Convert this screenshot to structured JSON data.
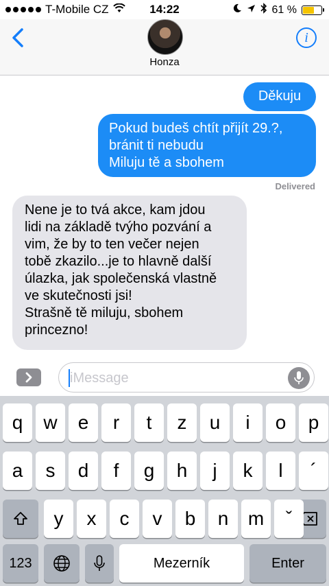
{
  "status_bar": {
    "carrier": "T-Mobile CZ",
    "time": "14:22",
    "battery_percent": "61 %",
    "battery_level": 0.61
  },
  "header": {
    "contact_name": "Honza",
    "back_icon": "chevron-left-icon",
    "info_icon": "info-icon",
    "accent": "#147efb"
  },
  "messages": [
    {
      "direction": "sent",
      "lines": [
        "Děkuju"
      ]
    },
    {
      "direction": "sent",
      "lines": [
        "Pokud budeš chtít přijít 29.?,",
        "bránit ti nebudu",
        "Miluju tě a sbohem"
      ]
    },
    {
      "direction": "received",
      "lines": [
        "Nene je to tvá akce, kam jdou",
        "lidi na základě tvýho pozvání a",
        "vim, že by to ten večer nejen",
        "tobě zkazilo...je to hlavně další",
        "úlazka, jak společenská vlastně",
        "ve skutečnosti jsi!",
        "Strašně tě miluju, sbohem",
        "princezno!"
      ]
    }
  ],
  "delivered_label": "Delivered",
  "input": {
    "placeholder": "iMessage",
    "value": ""
  },
  "keyboard": {
    "row1": [
      "q",
      "w",
      "e",
      "r",
      "t",
      "z",
      "u",
      "i",
      "o",
      "p"
    ],
    "row2": [
      "a",
      "s",
      "d",
      "f",
      "g",
      "h",
      "j",
      "k",
      "l",
      "´"
    ],
    "row3": [
      "y",
      "x",
      "c",
      "v",
      "b",
      "n",
      "m",
      "ˇ"
    ],
    "numbers_label": "123",
    "space_label": "Mezerník",
    "return_label": "Enter"
  },
  "colors": {
    "sent_bubble": "#1c8cf6",
    "received_bubble": "#e5e5ea",
    "keyboard_bg": "#d1d4d9"
  }
}
